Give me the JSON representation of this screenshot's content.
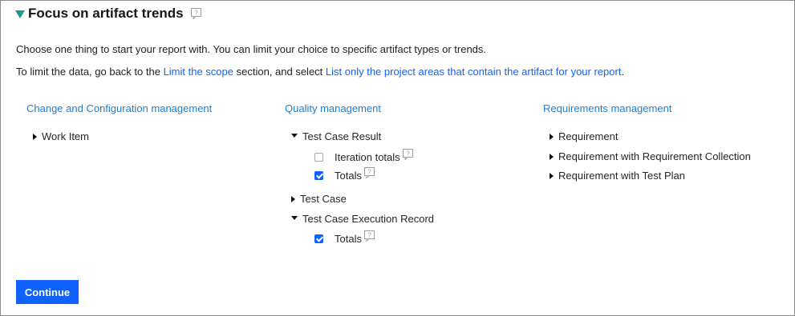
{
  "section": {
    "title": "Focus on artifact trends"
  },
  "intro": {
    "line1": "Choose one thing to start your report with. You can limit your choice to specific artifact types or trends.",
    "line2_part1": "To limit the data, go back to the ",
    "line2_link1": "Limit the scope",
    "line2_part2": " section, and select ",
    "line2_link2": "List only the project areas that contain the artifact for your report",
    "line2_part3": "."
  },
  "columns": {
    "ccm": {
      "heading": "Change and Configuration management",
      "items": [
        {
          "label": "Work Item",
          "expanded": false
        }
      ]
    },
    "qm": {
      "heading": "Quality management",
      "items": [
        {
          "label": "Test Case Result",
          "expanded": true
        },
        {
          "label": "Test Case",
          "expanded": false
        },
        {
          "label": "Test Case Execution Record",
          "expanded": true
        }
      ],
      "test_case_result_options": [
        {
          "label": "Iteration totals",
          "checked": false
        },
        {
          "label": "Totals",
          "checked": true
        }
      ],
      "tcer_options": [
        {
          "label": "Totals",
          "checked": true
        }
      ]
    },
    "rm": {
      "heading": "Requirements management",
      "items": [
        {
          "label": "Requirement",
          "expanded": false
        },
        {
          "label": "Requirement with Requirement Collection",
          "expanded": false
        },
        {
          "label": "Requirement with Test Plan",
          "expanded": false
        }
      ]
    }
  },
  "footer": {
    "continue_label": "Continue"
  },
  "icons": {
    "section_toggle": "triangle-down-icon",
    "help": "help-icon",
    "collapsed": "caret-right-icon",
    "expanded": "caret-down-icon"
  },
  "colors": {
    "accent": "#0f62fe",
    "heading_link": "#1d7fd0",
    "section_toggle": "#1b9a8a"
  }
}
